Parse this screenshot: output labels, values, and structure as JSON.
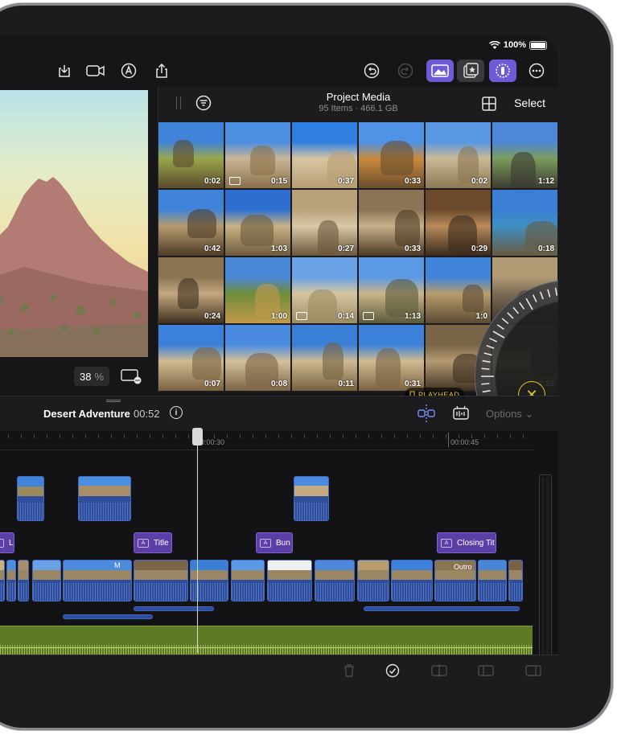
{
  "status_bar": {
    "battery": "100%"
  },
  "toolbar": {
    "icons": [
      "import-icon",
      "camera-icon",
      "voiceover-icon",
      "share-icon",
      "undo-icon",
      "redo-icon",
      "photos-icon",
      "favorites-icon",
      "inspector-icon",
      "more-icon"
    ]
  },
  "viewer": {
    "zoom_value": "38",
    "zoom_unit": "%"
  },
  "browser": {
    "title": "Project Media",
    "item_count": "95 Items",
    "size": "466.1 GB",
    "select_label": "Select",
    "thumbnails": [
      {
        "dur": "0:02",
        "cam": false,
        "colors": [
          "#3f84d8",
          "#9aa64c",
          "#5a4a2c"
        ]
      },
      {
        "dur": "0:15",
        "cam": true,
        "colors": [
          "#4b8fe0",
          "#c9b597",
          "#8a7048"
        ]
      },
      {
        "dur": "0:37",
        "cam": false,
        "colors": [
          "#2f7fe0",
          "#d7c6a3",
          "#b89d73"
        ]
      },
      {
        "dur": "0:33",
        "cam": false,
        "colors": [
          "#4f92e6",
          "#c98a3e",
          "#6b4e2d"
        ]
      },
      {
        "dur": "0:02",
        "cam": false,
        "colors": [
          "#5a97e2",
          "#cbb995",
          "#8c7755"
        ]
      },
      {
        "dur": "1:12",
        "cam": false,
        "colors": [
          "#4d87d7",
          "#7b9c5d",
          "#3b3b30"
        ]
      },
      {
        "dur": "0:42",
        "cam": false,
        "colors": [
          "#3f84d8",
          "#b49b6e",
          "#4e3c28"
        ]
      },
      {
        "dur": "1:03",
        "cam": false,
        "colors": [
          "#2d6fd0",
          "#c8b285",
          "#6e5a3c"
        ]
      },
      {
        "dur": "0:27",
        "cam": false,
        "colors": [
          "#b9a27b",
          "#d8c8a7",
          "#6a563c"
        ]
      },
      {
        "dur": "0:33",
        "cam": false,
        "colors": [
          "#8c7556",
          "#c7b08a",
          "#4c3a25"
        ]
      },
      {
        "dur": "0:29",
        "cam": false,
        "colors": [
          "#6b4a2c",
          "#b88a5c",
          "#3a2a1c"
        ]
      },
      {
        "dur": "0:18",
        "cam": false,
        "colors": [
          "#3a7fd4",
          "#3d8fc2",
          "#6a5a3e"
        ]
      },
      {
        "dur": "0:24",
        "cam": false,
        "colors": [
          "#8a7452",
          "#c4a77f",
          "#3e3020"
        ]
      },
      {
        "dur": "1:00",
        "cam": false,
        "colors": [
          "#4a86d6",
          "#6e8c3a",
          "#c19a4c"
        ]
      },
      {
        "dur": "0:14",
        "cam": true,
        "colors": [
          "#6aa2e6",
          "#d6c6a0",
          "#9b8a62"
        ]
      },
      {
        "dur": "1:13",
        "cam": true,
        "colors": [
          "#5b99e4",
          "#cbb48a",
          "#5a5a3a"
        ]
      },
      {
        "dur": "1:0",
        "cam": false,
        "colors": [
          "#3f84d8",
          "#b89c6c",
          "#5b4a33"
        ]
      },
      {
        "dur": "",
        "cam": false,
        "colors": [
          "#b19b75",
          "#7a6b55",
          "#3e352b"
        ]
      },
      {
        "dur": "0:07",
        "cam": false,
        "colors": [
          "#3b80d9",
          "#d2bc93",
          "#7a6240"
        ]
      },
      {
        "dur": "0:08",
        "cam": false,
        "colors": [
          "#4a8be0",
          "#d4c09a",
          "#7c6444"
        ]
      },
      {
        "dur": "0:11",
        "cam": false,
        "colors": [
          "#3a7fd6",
          "#cfba92",
          "#75603f"
        ]
      },
      {
        "dur": "0:31",
        "cam": false,
        "colors": [
          "#3c82da",
          "#d1bb91",
          "#7b6242"
        ]
      },
      {
        "dur": "",
        "cam": false,
        "colors": [
          "#7a6448",
          "#b59b72",
          "#3e3021"
        ]
      },
      {
        "dur": "0:32",
        "cam": false,
        "colors": [
          "#5b4a36",
          "#a08862",
          "#2a2218"
        ]
      }
    ],
    "playhead_badge": "PLAYHEAD"
  },
  "timeline": {
    "project_name": "Desert Adventure",
    "project_duration": "00:52",
    "options_label": "Options",
    "ruler": [
      "00:00:30",
      "00:00:45"
    ],
    "titles": [
      {
        "label": "L"
      },
      {
        "label": "Title"
      },
      {
        "label": "Bun"
      },
      {
        "label": "Closing Tit"
      }
    ],
    "clip_labels": {
      "m_clip": "M",
      "outro_clip": "Outro"
    }
  },
  "bottom_bar": {
    "icons": [
      "trash-icon",
      "checkmark-icon",
      "split-icon",
      "detach-icon",
      "crop-icon"
    ]
  }
}
